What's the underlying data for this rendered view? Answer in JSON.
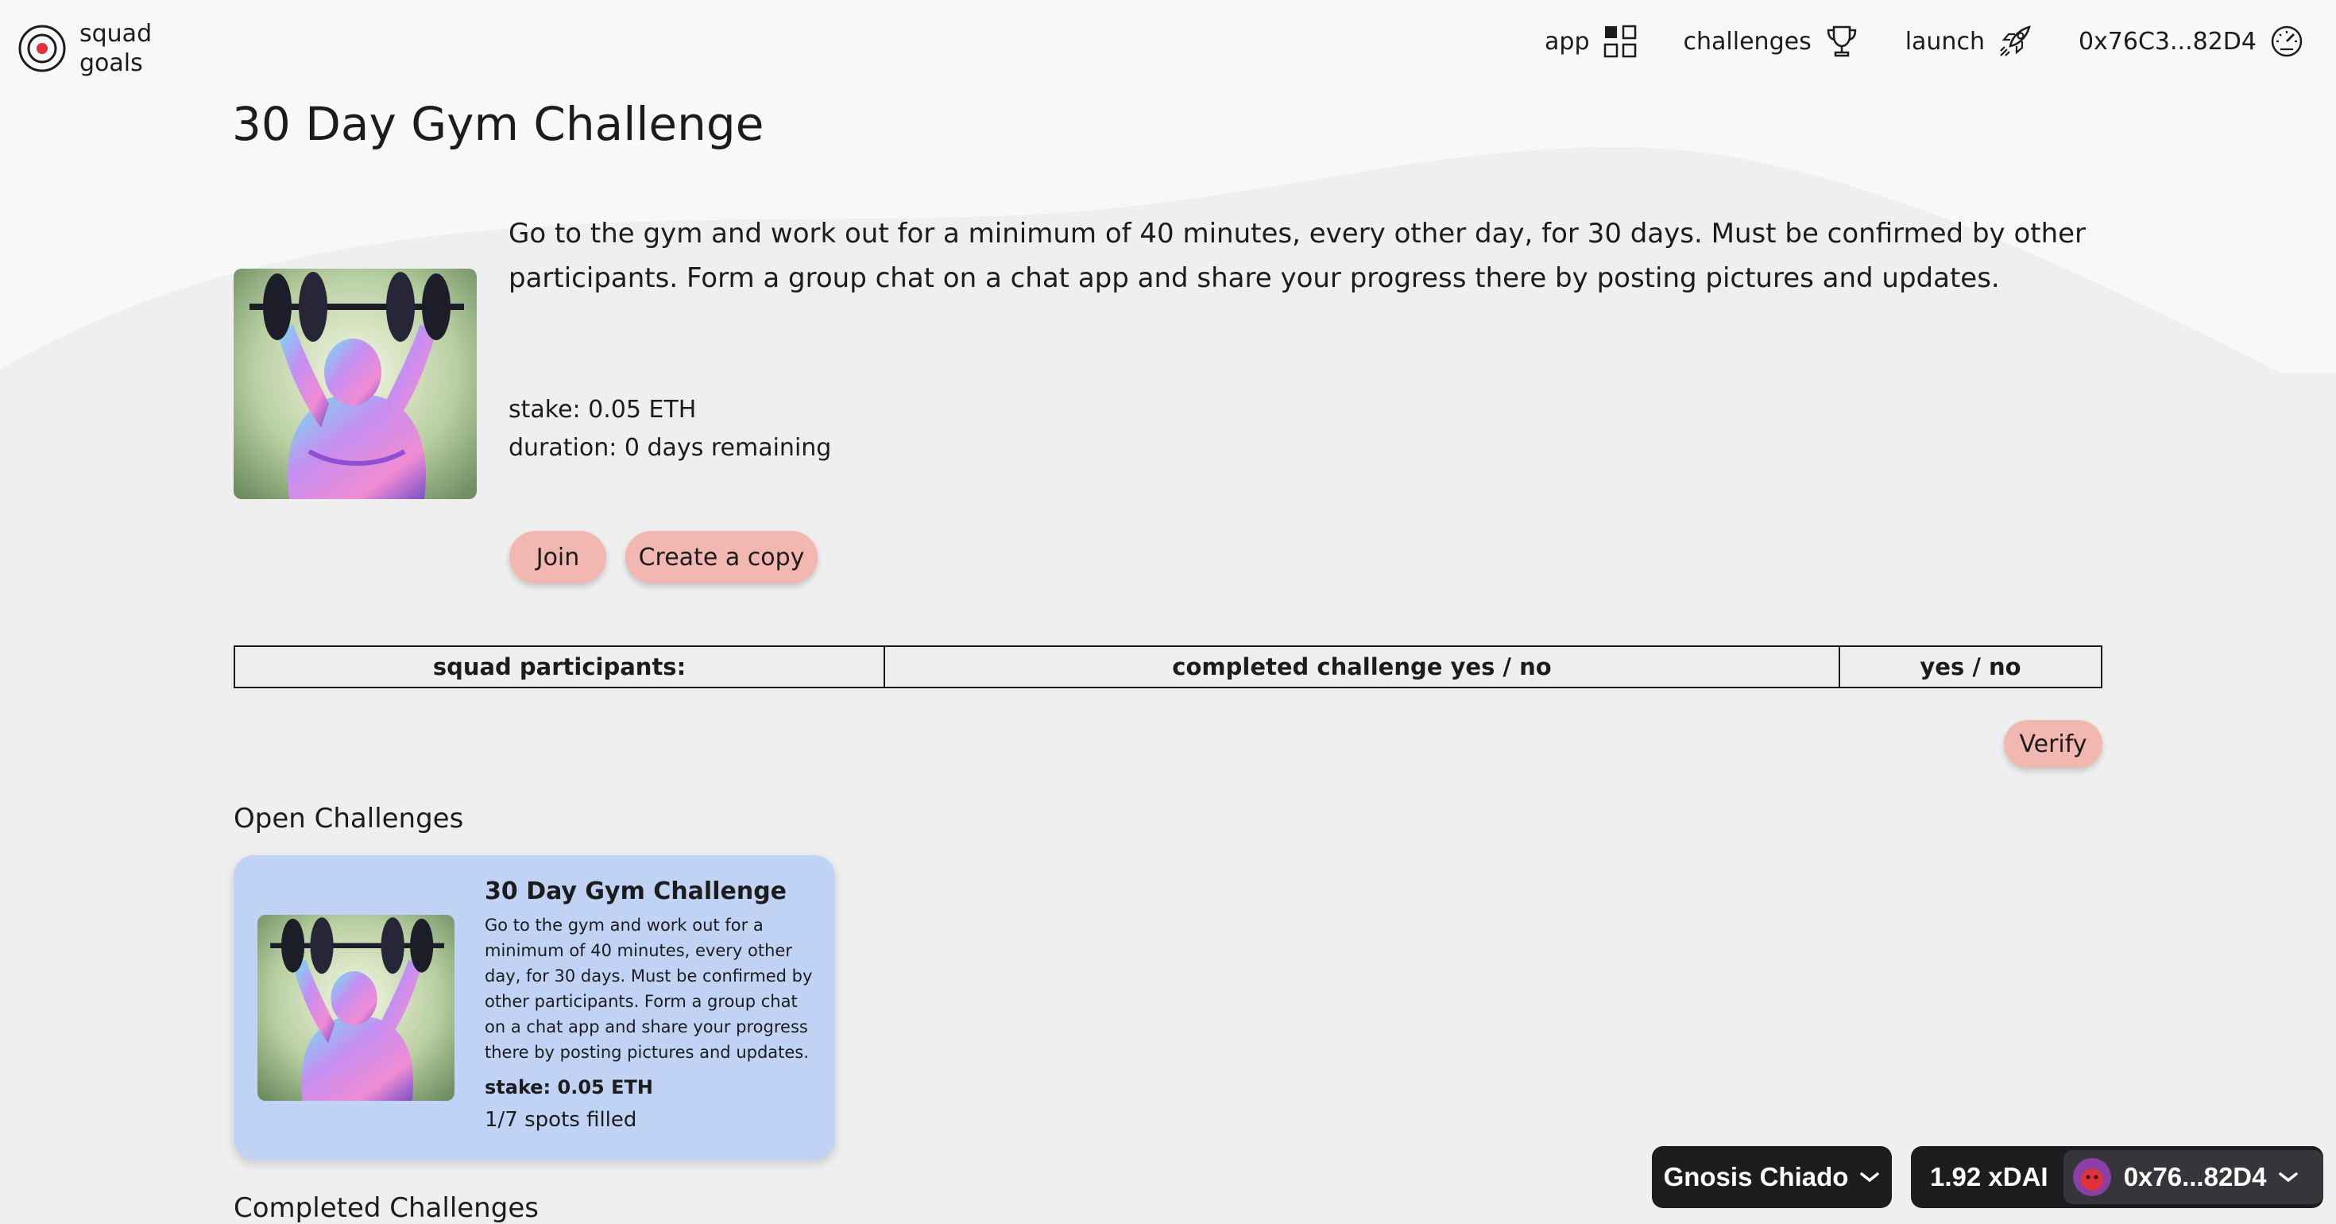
{
  "brand": {
    "name_line1": "squad",
    "name_line2": "goals"
  },
  "nav": {
    "app": "app",
    "challenges": "challenges",
    "launch": "launch",
    "account": "0x76C3...82D4"
  },
  "challenge": {
    "title": "30 Day Gym Challenge",
    "description": "Go to the gym and work out for a minimum of 40 minutes, every other day, for 30 days. Must be confirmed by other participants. Form a group chat on a chat app and share your progress there by posting pictures and updates.",
    "stake": "stake: 0.05 ETH",
    "duration": "duration: 0 days remaining",
    "join_label": "Join",
    "copy_label": "Create a copy"
  },
  "participants_table": {
    "headers": [
      "squad participants:",
      "completed challenge yes / no",
      "yes / no"
    ]
  },
  "verify_label": "Verify",
  "open_challenges": {
    "title": "Open Challenges",
    "cards": [
      {
        "title": "30 Day Gym Challenge",
        "description": "Go to the gym and work out for a minimum of 40 minutes, every other day, for 30 days. Must be confirmed by other participants. Form a group chat on a chat app and share your progress there by posting pictures and updates.",
        "stake": "stake: 0.05 ETH",
        "spots": "1/7 spots filled"
      }
    ]
  },
  "completed_challenges": {
    "title": "Completed Challenges"
  },
  "wallet": {
    "network": "Gnosis Chiado",
    "balance": "1.92 xDAI",
    "address": "0x76...82D4"
  },
  "colors": {
    "pill_button": "#f2b7b1",
    "card_bg": "#c0d3f5",
    "wallet_bg": "#1d1d1f",
    "logo_dot": "#e0323c"
  }
}
